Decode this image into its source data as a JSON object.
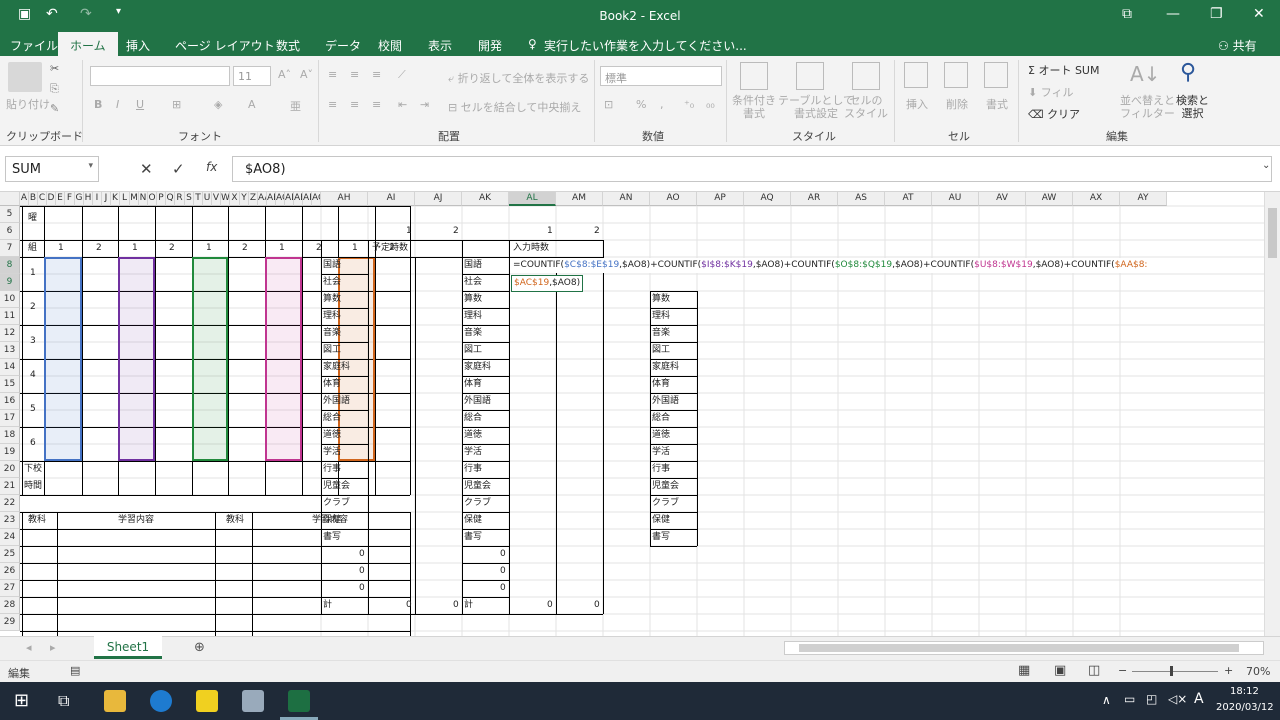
{
  "window": {
    "title": "Book2 - Excel",
    "share_label": "共有"
  },
  "tabs": [
    "ファイル",
    "ホーム",
    "挿入",
    "ページ レイアウト",
    "数式",
    "データ",
    "校閲",
    "表示",
    "開発"
  ],
  "tell_me": "実行したい作業を入力してください...",
  "ribbon": {
    "clipboard": {
      "paste": "貼り付け",
      "group": "クリップボード"
    },
    "font": {
      "size": "11",
      "group": "フォント"
    },
    "alignment": {
      "wrap": "折り返して全体を表示する",
      "merge": "セルを結合して中央揃え",
      "group": "配置"
    },
    "number": {
      "format": "標準",
      "group": "数値"
    },
    "styles": {
      "conditional": "条件付き\n書式",
      "table": "テーブルとして\n書式設定",
      "cell": "セルの\nスタイル",
      "group": "スタイル"
    },
    "cells": {
      "insert": "挿入",
      "delete": "削除",
      "format": "書式",
      "group": "セル"
    },
    "editing": {
      "autosum": "オート SUM",
      "fill": "フィル",
      "clear": "クリア",
      "sort": "並べ替えと\nフィルター",
      "find": "検索と\n選択",
      "group": "編集"
    }
  },
  "formula_bar": {
    "name_box": "SUM",
    "formula": "$AO8)"
  },
  "columns_left": [
    "A",
    "B",
    "C",
    "D",
    "E",
    "F",
    "G",
    "H",
    "I",
    "J",
    "K",
    "L",
    "M",
    "N",
    "O",
    "P",
    "Q",
    "R",
    "S",
    "T",
    "U",
    "V",
    "W",
    "X",
    "Y",
    "Z",
    "AA",
    "AB",
    "AC",
    "AD",
    "AE",
    "AF",
    "AG"
  ],
  "columns_right": [
    "AH",
    "AI",
    "AJ",
    "AK",
    "AL",
    "AM",
    "AN",
    "AO",
    "AP",
    "AQ",
    "AR",
    "AS",
    "AT",
    "AU",
    "AV",
    "AW",
    "AX",
    "AY"
  ],
  "rows": [
    "5",
    "6",
    "7",
    "8",
    "9",
    "10",
    "11",
    "12",
    "13",
    "14",
    "15",
    "16",
    "17",
    "18",
    "19",
    "20",
    "21",
    "22",
    "23",
    "24",
    "25",
    "26",
    "27",
    "28",
    "29"
  ],
  "timetable": {
    "row5_label": "曜",
    "row7_label": "組",
    "col_nums": [
      "1",
      "2",
      "1",
      "2",
      "1",
      "2",
      "1",
      "2",
      "1",
      "2"
    ],
    "periods": [
      "1",
      "2",
      "3",
      "4",
      "5",
      "6"
    ],
    "after_school": [
      "下校",
      "時間"
    ],
    "subject_hdr": "教科",
    "content_hdr": "学習内容"
  },
  "table1": {
    "nums": [
      "1",
      "2"
    ],
    "header": "予定時数"
  },
  "table2": {
    "nums": [
      "1",
      "2"
    ],
    "header": "入力時数"
  },
  "subjects": [
    "国語",
    "社会",
    "算数",
    "理科",
    "音楽",
    "図工",
    "家庭科",
    "体育",
    "外国語",
    "総合",
    "道徳",
    "学活",
    "行事",
    "児童会",
    "クラブ",
    "保健",
    "書写"
  ],
  "subjects_ao": [
    "算数",
    "理科",
    "音楽",
    "図工",
    "家庭科",
    "体育",
    "外国語",
    "総合",
    "道徳",
    "学活",
    "行事",
    "児童会",
    "クラブ",
    "保健",
    "書写"
  ],
  "zeros": [
    "0",
    "0",
    "0"
  ],
  "total_label": "計",
  "totals": [
    "0",
    "0",
    "0",
    "0"
  ],
  "edit_formula": {
    "p1": "=COUNTIF(",
    "r1": "$C$8:$E$19",
    "p2": ",$AO8)+COUNTIF(",
    "r2": "$I$8:$K$19",
    "p3": ",$AO8)+COUNTIF(",
    "r3": "$O$8:$Q$19",
    "p4": ",$AO8)+COUNTIF(",
    "r4": "$U$8:$W$19",
    "p5": ",$AO8)+COUNTIF(",
    "r5": "$AA$8:",
    "l2a": "$AC$19",
    "l2b": ",$AO8)"
  },
  "sheet": {
    "name": "Sheet1"
  },
  "status": {
    "mode": "編集",
    "zoom": "70%"
  },
  "taskbar": {
    "time": "18:12",
    "date": "2020/03/12"
  },
  "colors": {
    "excel_green": "#217346",
    "band1": "#4472c4",
    "band2": "#7030a0",
    "band3": "#218a3c",
    "band4": "#c03590",
    "band5": "#d0651c"
  }
}
